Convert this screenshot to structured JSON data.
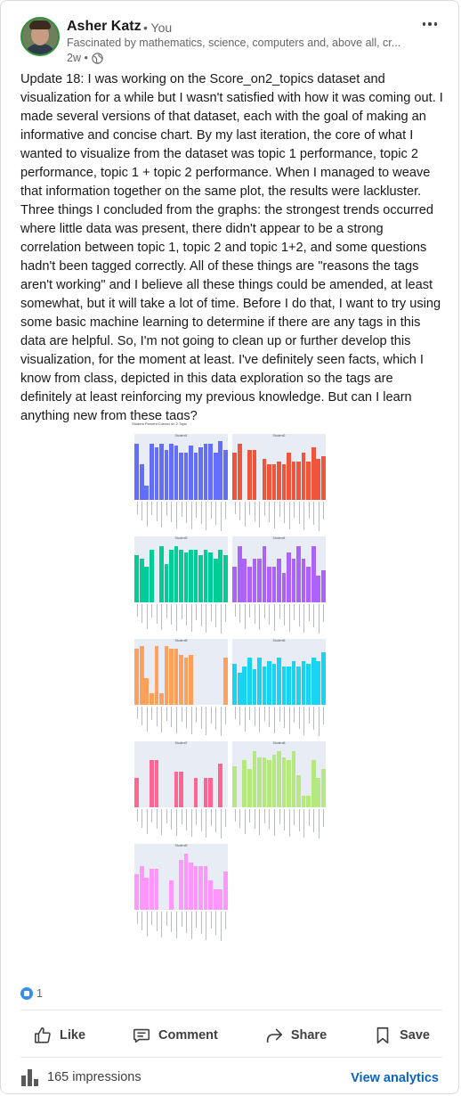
{
  "author": {
    "name": "Asher Katz",
    "relation": "• You",
    "headline": "Fascinated by mathematics, science, computers and, above all, cr...",
    "time": "2w •"
  },
  "post": {
    "text": "Update 18: I was working on the Score_on2_topics dataset and visualization for a while but I wasn't satisfied with how it was coming out. I made several versions of that dataset, each with the goal of making an informative and concise chart. By my last iteration, the core of what I wanted to visualize from the dataset was topic 1 performance, topic 2 performance, topic 1 + topic 2 performance. When I managed to weave that information together on the same plot, the results were lackluster. Three things I concluded from the graphs: the strongest trends occurred where little data was present, there didn't appear to be a strong correlation between topic 1, topic 2 and topic 1+2, and some questions hadn't been tagged correctly. All of these things are \"reasons the tags aren't working\" and I believe all these things could be amended, at least somewhat, but it will take a lot of time. Before I do that, I want to try using some basic machine learning to determine if there are any tags in this data are helpful. So, I'm not going to clean up or further develop this visualization, for the moment at least. I've definitely seen facts, which I know from class, depicted in this data exploration so the tags are definitely at least reinforcing my previous knowledge. But can I learn anything new from these tags?"
  },
  "image": {
    "title": "Student Percent Correct on 2 Topic",
    "panels": [
      {
        "name": "Student1",
        "color": "#636efa",
        "values": [
          95,
          60,
          25,
          95,
          90,
          95,
          85,
          95,
          92,
          80,
          80,
          92,
          80,
          90,
          95,
          95,
          80,
          100,
          85
        ]
      },
      {
        "name": "Student2",
        "color": "#ef553b",
        "values": [
          80,
          95,
          0,
          85,
          85,
          0,
          70,
          60,
          60,
          65,
          60,
          80,
          65,
          65,
          80,
          65,
          90,
          70,
          75
        ]
      },
      {
        "name": "Student3",
        "color": "#00cc96",
        "values": [
          80,
          75,
          60,
          90,
          0,
          95,
          65,
          90,
          95,
          90,
          85,
          90,
          90,
          80,
          90,
          85,
          75,
          90,
          80
        ]
      },
      {
        "name": "Student4",
        "color": "#ab63fa",
        "values": [
          60,
          95,
          75,
          60,
          75,
          75,
          95,
          60,
          60,
          75,
          50,
          85,
          75,
          95,
          75,
          60,
          95,
          45,
          55
        ]
      },
      {
        "name": "Student5",
        "color": "#ffa15a",
        "values": [
          95,
          100,
          45,
          20,
          100,
          20,
          100,
          95,
          95,
          85,
          80,
          85,
          0,
          0,
          0,
          0,
          0,
          0,
          80
        ]
      },
      {
        "name": "Student6",
        "color": "#19d3f3",
        "values": [
          70,
          55,
          65,
          80,
          60,
          80,
          65,
          75,
          70,
          80,
          65,
          65,
          75,
          65,
          75,
          70,
          80,
          75,
          90
        ]
      },
      {
        "name": "Student7",
        "color": "#ff6692",
        "values": [
          50,
          0,
          0,
          80,
          80,
          0,
          0,
          0,
          60,
          60,
          0,
          0,
          50,
          0,
          50,
          50,
          0,
          75,
          0
        ]
      },
      {
        "name": "Student8",
        "color": "#b6e880",
        "values": [
          70,
          0,
          80,
          65,
          95,
          85,
          85,
          80,
          90,
          95,
          85,
          80,
          95,
          55,
          20,
          20,
          80,
          50,
          65
        ]
      },
      {
        "name": "Student9",
        "color": "#ff97ff",
        "values": [
          60,
          75,
          55,
          70,
          70,
          0,
          0,
          50,
          0,
          85,
          95,
          80,
          75,
          75,
          75,
          50,
          35,
          35,
          65
        ]
      }
    ]
  },
  "social": {
    "reaction_count": "1",
    "like": "Like",
    "comment": "Comment",
    "share": "Share",
    "save": "Save",
    "impressions": "165 impressions",
    "analytics": "View analytics"
  }
}
